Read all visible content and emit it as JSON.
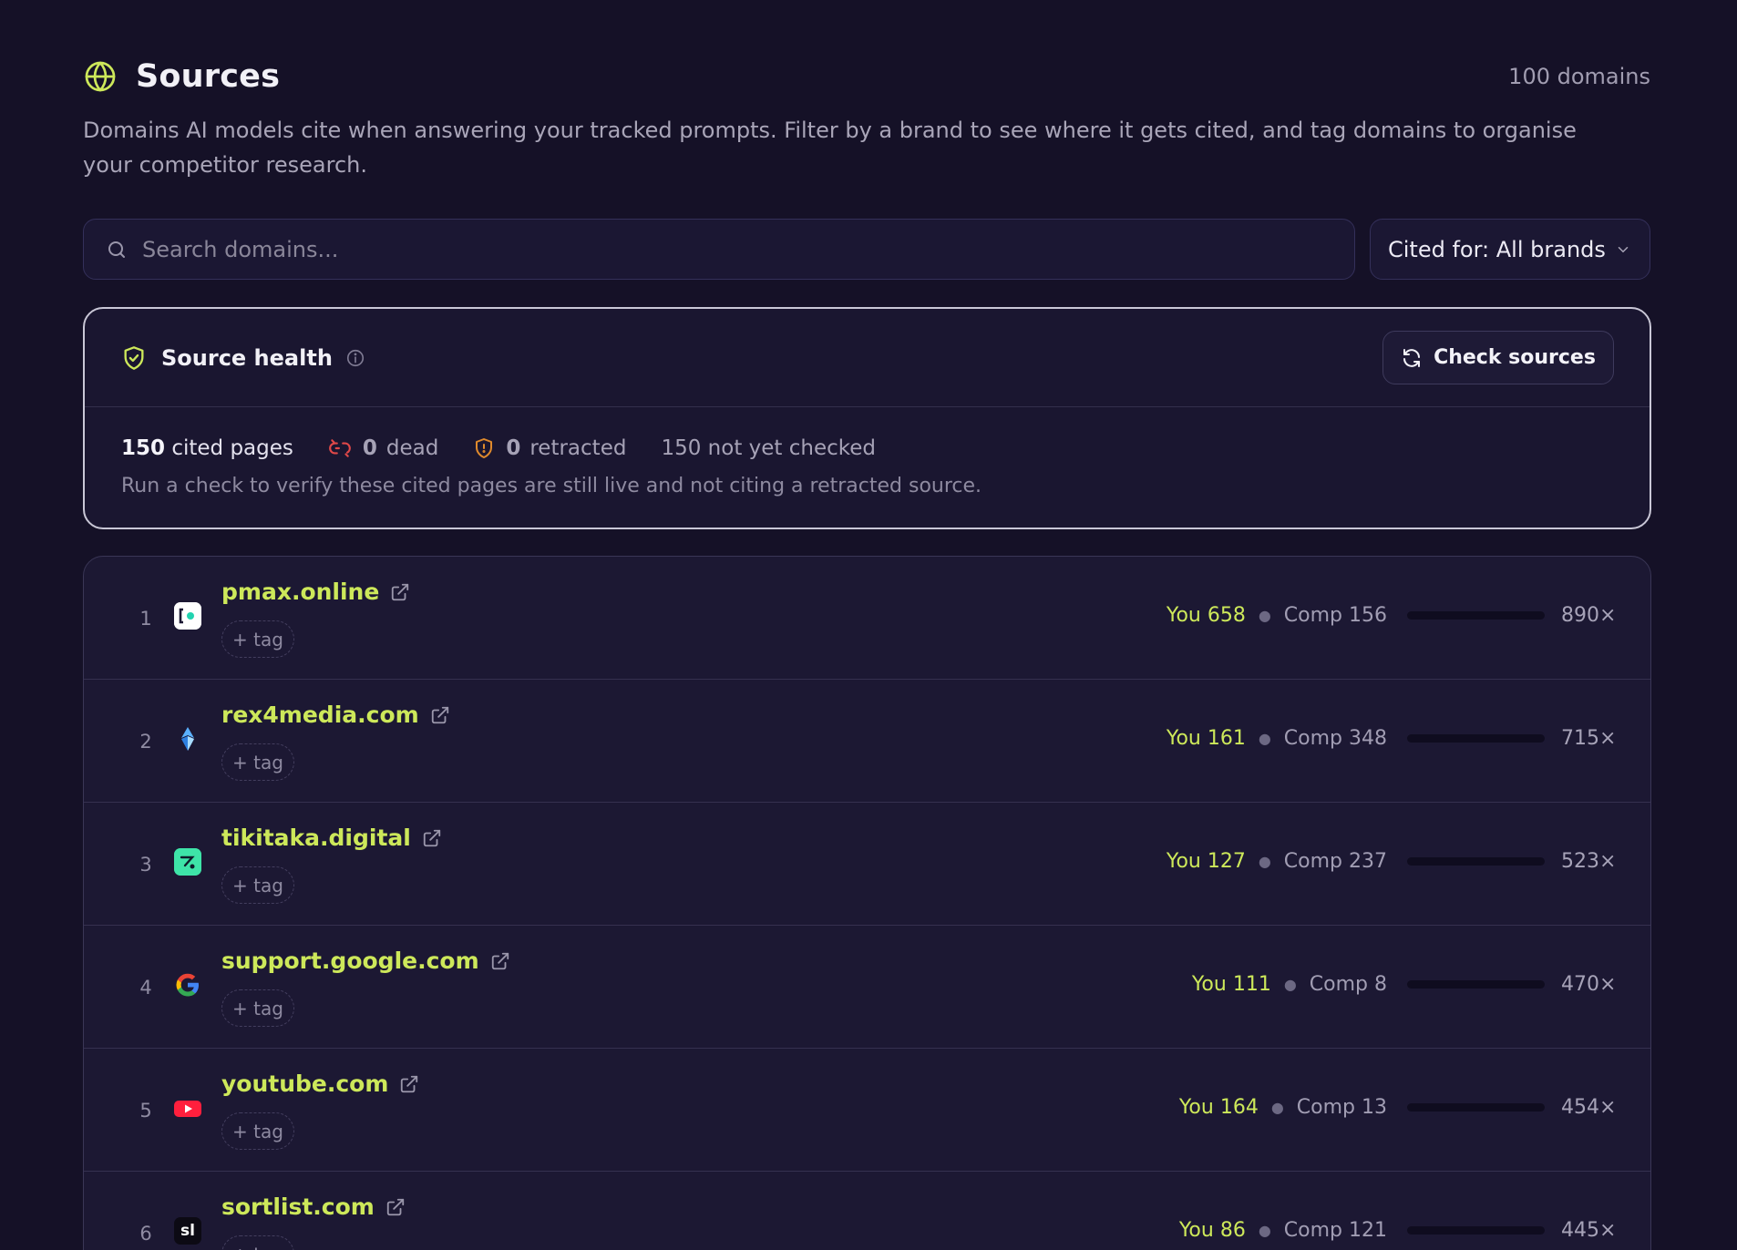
{
  "header": {
    "title": "Sources",
    "domain_count": "100 domains",
    "subtitle": "Domains AI models cite when answering your tracked prompts. Filter by a brand to see where it gets cited, and tag domains to organise your competitor research."
  },
  "search": {
    "placeholder": "Search domains..."
  },
  "brand_filter": {
    "label": "Cited for: All brands"
  },
  "health": {
    "title": "Source health",
    "check_button": "Check sources",
    "cited_pages_count": "150",
    "cited_pages_label": "cited pages",
    "dead_count": "0",
    "dead_label": "dead",
    "retracted_count": "0",
    "retracted_label": "retracted",
    "not_checked": "150 not yet checked",
    "note": "Run a check to verify these cited pages are still live and not citing a retracted source."
  },
  "tag_label": "+ tag",
  "rows": [
    {
      "index": "1",
      "domain": "pmax.online",
      "you": "You 658",
      "comp": "Comp 156",
      "total": "890×"
    },
    {
      "index": "2",
      "domain": "rex4media.com",
      "you": "You 161",
      "comp": "Comp 348",
      "total": "715×"
    },
    {
      "index": "3",
      "domain": "tikitaka.digital",
      "you": "You 127",
      "comp": "Comp 237",
      "total": "523×"
    },
    {
      "index": "4",
      "domain": "support.google.com",
      "you": "You 111",
      "comp": "Comp 8",
      "total": "470×"
    },
    {
      "index": "5",
      "domain": "youtube.com",
      "you": "You 164",
      "comp": "Comp 13",
      "total": "454×"
    },
    {
      "index": "6",
      "domain": "sortlist.com",
      "you": "You 86",
      "comp": "Comp 121",
      "total": "445×",
      "favicon_text": "sl"
    }
  ],
  "colors": {
    "accent": "#cde85a",
    "background": "#151127",
    "dead": "#e04848",
    "retracted": "#e08a2c"
  }
}
